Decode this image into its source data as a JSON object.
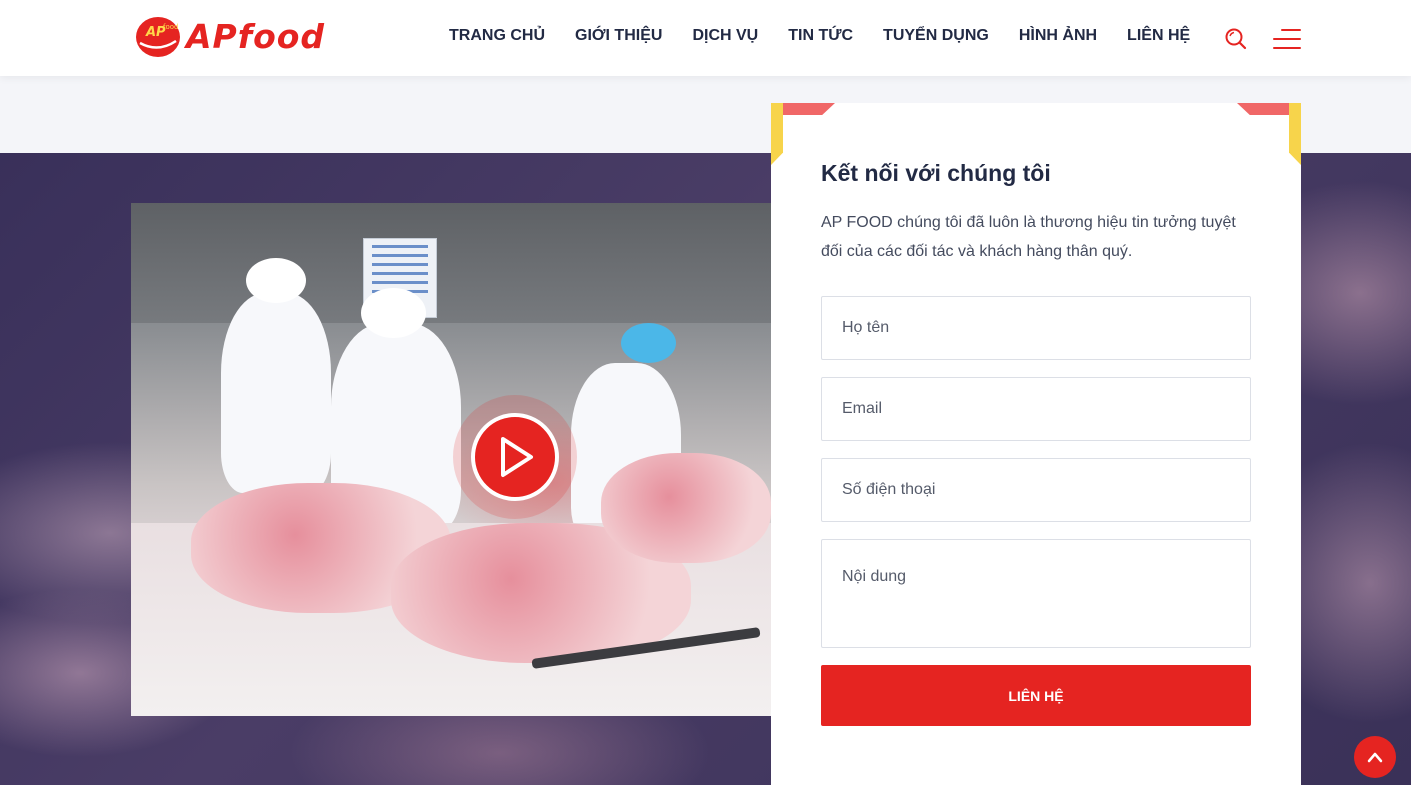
{
  "brand": {
    "logo_text": "APfood",
    "badge_text": "AP",
    "badge_sub": "food",
    "accent": "#e52421"
  },
  "nav": {
    "items": [
      {
        "label": "TRANG CHỦ"
      },
      {
        "label": "GIỚI THIỆU"
      },
      {
        "label": "DỊCH VỤ"
      },
      {
        "label": "TIN TỨC"
      },
      {
        "label": "TUYỂN DỤNG"
      },
      {
        "label": "HÌNH ẢNH"
      },
      {
        "label": "LIÊN HỆ"
      }
    ],
    "search_icon": "search-icon",
    "menu_icon": "hamburger-menu-icon"
  },
  "video": {
    "play_icon": "play-icon"
  },
  "contact": {
    "title": "Kết nối với chúng tôi",
    "description": "AP FOOD chúng tôi đã luôn là thương hiệu tin tưởng tuyệt đối của các đối tác và khách hàng thân quý.",
    "fields": {
      "name_placeholder": "Họ tên",
      "email_placeholder": "Email",
      "phone_placeholder": "Số điện thoại",
      "message_placeholder": "Nội dung"
    },
    "submit_label": "LIÊN HỆ"
  },
  "scroll_top_icon": "chevron-up-icon"
}
